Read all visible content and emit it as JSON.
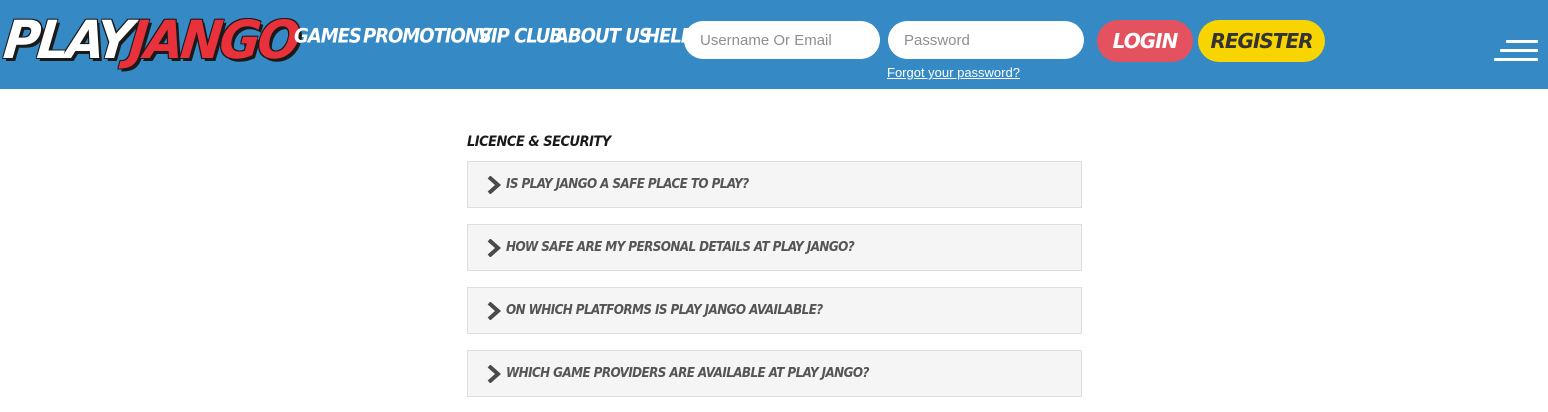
{
  "header": {
    "logo": {
      "part1": "PLAY",
      "part2": "JANGO"
    },
    "nav": [
      {
        "label": "GAMES"
      },
      {
        "label": "PROMOTIONS"
      },
      {
        "label": "VIP CLUB"
      },
      {
        "label": "ABOUT US"
      },
      {
        "label": "HELP"
      }
    ],
    "username_placeholder": "Username Or Email",
    "password_placeholder": "Password",
    "forgot_label": "Forgot your password?",
    "login_label": "LOGIN",
    "register_label": "REGISTER",
    "menu_icon": "hamburger-menu-icon"
  },
  "colors": {
    "header_bg": "#3589c4",
    "login_bg": "#e4525f",
    "register_bg": "#f8d400",
    "logo_red": "#e8313a"
  },
  "faq": {
    "title": "LICENCE & SECURITY",
    "items": [
      {
        "question": "IS PLAY JANGO A SAFE PLACE TO PLAY?",
        "icon": "chevron-right-icon"
      },
      {
        "question": "HOW SAFE ARE MY PERSONAL DETAILS AT PLAY JANGO?",
        "icon": "chevron-right-icon"
      },
      {
        "question": "ON WHICH PLATFORMS IS PLAY JANGO AVAILABLE?",
        "icon": "chevron-right-icon"
      },
      {
        "question": "WHICH GAME PROVIDERS ARE AVAILABLE AT PLAY JANGO?",
        "icon": "chevron-right-icon"
      }
    ]
  }
}
